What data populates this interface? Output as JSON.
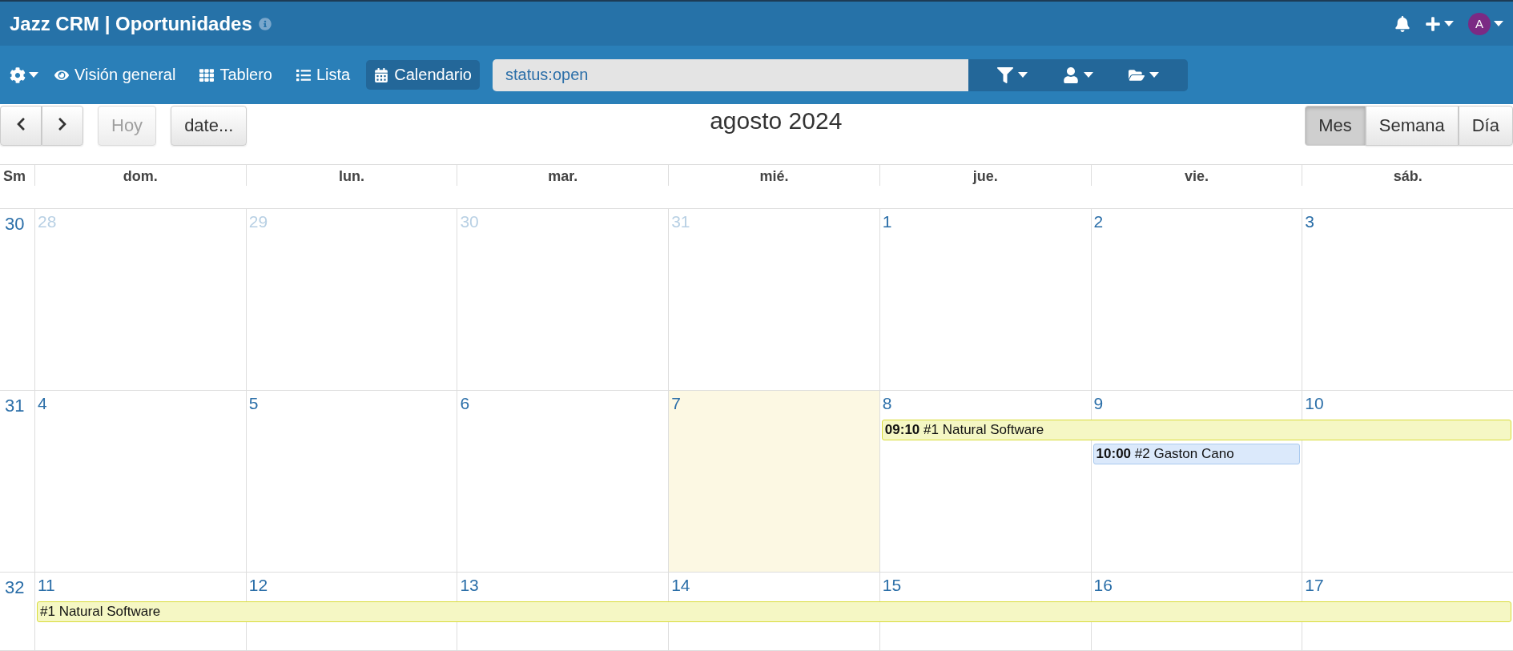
{
  "header": {
    "title": "Jazz CRM | Oportunidades",
    "avatar": "A"
  },
  "nav": {
    "views": [
      {
        "label": "Visión general",
        "selected": false
      },
      {
        "label": "Tablero",
        "selected": false
      },
      {
        "label": "Lista",
        "selected": false
      },
      {
        "label": "Calendario",
        "selected": true
      }
    ],
    "search": {
      "value": "status:open"
    }
  },
  "toolbar": {
    "today": {
      "label": "Hoy",
      "disabled": true
    },
    "date_button": "date...",
    "title": "agosto 2024",
    "view_modes": [
      {
        "label": "Mes",
        "selected": true
      },
      {
        "label": "Semana",
        "selected": false
      },
      {
        "label": "Día",
        "selected": false
      }
    ]
  },
  "calendar": {
    "week_label": "Sm",
    "weekdays": [
      "dom.",
      "lun.",
      "mar.",
      "mié.",
      "jue.",
      "vie.",
      "sáb."
    ],
    "weeks": [
      {
        "number": "30",
        "days": [
          {
            "date": "28",
            "other_month": true,
            "today": false
          },
          {
            "date": "29",
            "other_month": true,
            "today": false
          },
          {
            "date": "30",
            "other_month": true,
            "today": false
          },
          {
            "date": "31",
            "other_month": true,
            "today": false
          },
          {
            "date": "1",
            "other_month": false,
            "today": false
          },
          {
            "date": "2",
            "other_month": false,
            "today": false
          },
          {
            "date": "3",
            "other_month": false,
            "today": false
          }
        ]
      },
      {
        "number": "31",
        "days": [
          {
            "date": "4",
            "other_month": false,
            "today": false
          },
          {
            "date": "5",
            "other_month": false,
            "today": false
          },
          {
            "date": "6",
            "other_month": false,
            "today": false
          },
          {
            "date": "7",
            "other_month": false,
            "today": true
          },
          {
            "date": "8",
            "other_month": false,
            "today": false,
            "events": [
              {
                "time": "09:10",
                "text": "#1 Natural Software",
                "to_week_end": true,
                "color": "#f5f7c4"
              }
            ]
          },
          {
            "date": "9",
            "other_month": false,
            "today": false,
            "events": [
              {
                "time": "10:00",
                "text": "#2 Gaston Cano",
                "to_week_end": false,
                "color": "#dbe9fb"
              }
            ]
          },
          {
            "date": "10",
            "other_month": false,
            "today": false
          }
        ]
      },
      {
        "number": "32",
        "days": [
          {
            "date": "11",
            "other_month": false,
            "today": false,
            "events": [
              {
                "text": "#1 Natural Software",
                "to_week_end": true,
                "color": "#f5f7c4"
              }
            ]
          },
          {
            "date": "12",
            "other_month": false,
            "today": false
          },
          {
            "date": "13",
            "other_month": false,
            "today": false
          },
          {
            "date": "14",
            "other_month": false,
            "today": false
          },
          {
            "date": "15",
            "other_month": false,
            "today": false
          },
          {
            "date": "16",
            "other_month": false,
            "today": false
          },
          {
            "date": "17",
            "other_month": false,
            "today": false
          }
        ]
      }
    ]
  }
}
